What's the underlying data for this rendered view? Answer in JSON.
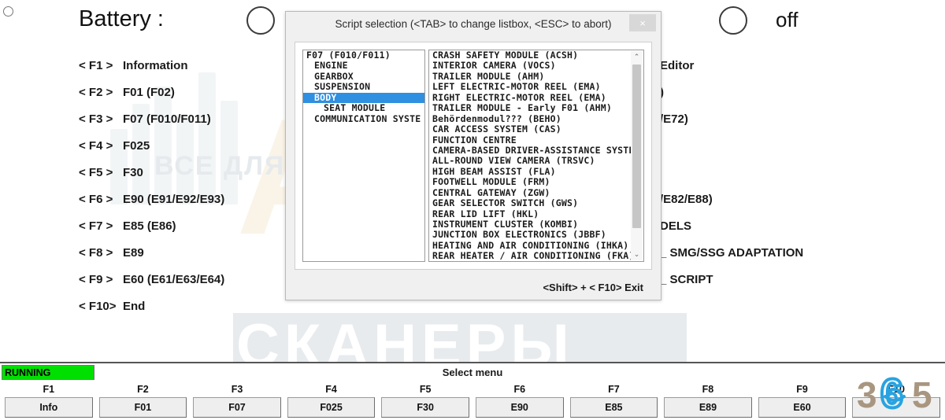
{
  "header": {
    "title": "Battery :",
    "off_label": "off",
    "indicator_left": "status-circle",
    "indicator_mid": "status-circle",
    "indicator_right": "status-circle"
  },
  "fmenu": [
    {
      "key": "< F1 >",
      "label": "Information"
    },
    {
      "key": "< F2 >",
      "label": "F01 (F02)"
    },
    {
      "key": "< F3 >",
      "label": "F07 (F010/F011)"
    },
    {
      "key": "< F4 >",
      "label": "F025"
    },
    {
      "key": "< F5 >",
      "label": "F30"
    },
    {
      "key": "< F6 >",
      "label": "E90 (E91/E92/E93)"
    },
    {
      "key": "< F7 >",
      "label": "E85 (E86)"
    },
    {
      "key": "< F8 >",
      "label": "E89"
    },
    {
      "key": "< F9 >",
      "label": "E60 (E61/E63/E64)"
    },
    {
      "key": "< F10>",
      "label": "End"
    }
  ],
  "right_column": [
    {
      "text": "Editor"
    },
    {
      "text": ")"
    },
    {
      "text": "/E72)"
    },
    {
      "text": ""
    },
    {
      "text": ""
    },
    {
      "text": "/E82/E88)"
    },
    {
      "text": "DELS"
    },
    {
      "text": "_ SMG/SSG ADAPTATION"
    },
    {
      "text": "_ SCRIPT"
    }
  ],
  "dialog": {
    "title": "Script selection   (<TAB> to change listbox, <ESC> to abort)",
    "close_label": "×",
    "exit_hint": "<Shift> + < F10>  Exit",
    "left_list": [
      {
        "text": "F07 (F010/F011)",
        "indent": 0,
        "selected": false
      },
      {
        "text": "ENGINE",
        "indent": 1,
        "selected": false
      },
      {
        "text": "GEARBOX",
        "indent": 1,
        "selected": false
      },
      {
        "text": "SUSPENSION",
        "indent": 1,
        "selected": false
      },
      {
        "text": "BODY",
        "indent": 1,
        "selected": true
      },
      {
        "text": "SEAT MODULE",
        "indent": 2,
        "selected": false
      },
      {
        "text": "COMMUNICATION SYSTE",
        "indent": 1,
        "selected": false
      }
    ],
    "right_list": [
      {
        "text": "CRASH SAFETY MODULE (ACSH)"
      },
      {
        "text": "INTERIOR CAMERA (VOCS)"
      },
      {
        "text": "TRAILER MODULE (AHM)"
      },
      {
        "text": "LEFT ELECTRIC-MOTOR REEL (EMA)"
      },
      {
        "text": "RIGHT ELECTRIC-MOTOR REEL (EMA)"
      },
      {
        "text": "TRAILER MODULE - Early F01 (AHM)"
      },
      {
        "text": "Behördenmodul??? (BEHO)"
      },
      {
        "text": "CAR ACCESS SYSTEM (CAS)"
      },
      {
        "text": "FUNCTION CENTRE"
      },
      {
        "text": "CAMERA-BASED DRIVER-ASSISTANCE SYSTEM"
      },
      {
        "text": "ALL-ROUND VIEW CAMERA (TRSVC)"
      },
      {
        "text": "HIGH BEAM ASSIST (FLA)"
      },
      {
        "text": "FOOTWELL MODULE (FRM)"
      },
      {
        "text": "CENTRAL GATEWAY (ZGW)"
      },
      {
        "text": "GEAR SELECTOR SWITCH (GWS)"
      },
      {
        "text": "REAR LID LIFT (HKL)"
      },
      {
        "text": "INSTRUMENT CLUSTER (KOMBI)"
      },
      {
        "text": "JUNCTION BOX ELECTRONICS (JBBF)"
      },
      {
        "text": "HEATING AND AIR CONDITIONING (IHKA)"
      },
      {
        "text": "REAR HEATER / AIR CONDITIONING (FKA)"
      }
    ],
    "scroll_up_glyph": "⌃",
    "scroll_down_glyph": "⌄"
  },
  "bottom": {
    "status": "RUNNING",
    "select_menu": "Select menu",
    "keys": [
      {
        "key": "F1",
        "label": "Info"
      },
      {
        "key": "F2",
        "label": "F01"
      },
      {
        "key": "F3",
        "label": "F07"
      },
      {
        "key": "F4",
        "label": "F025"
      },
      {
        "key": "F5",
        "label": "F30"
      },
      {
        "key": "F6",
        "label": "E90"
      },
      {
        "key": "F7",
        "label": "E85"
      },
      {
        "key": "F8",
        "label": "E89"
      },
      {
        "key": "F9",
        "label": "E60"
      },
      {
        "key": "F10",
        "label": ""
      }
    ]
  },
  "watermark": {
    "top_text": "ВСЕ ДЛЯ АВТОСЕРВИСА",
    "bottom_text": "СКАНЕРЫ",
    "logo_left": "3",
    "logo_mid": "6",
    "logo_right": "5"
  },
  "colors": {
    "status_green": "#00e000",
    "selection_blue": "#2f8fe0",
    "logo_blue": "#29a3e0",
    "logo_tan": "#a89680"
  }
}
